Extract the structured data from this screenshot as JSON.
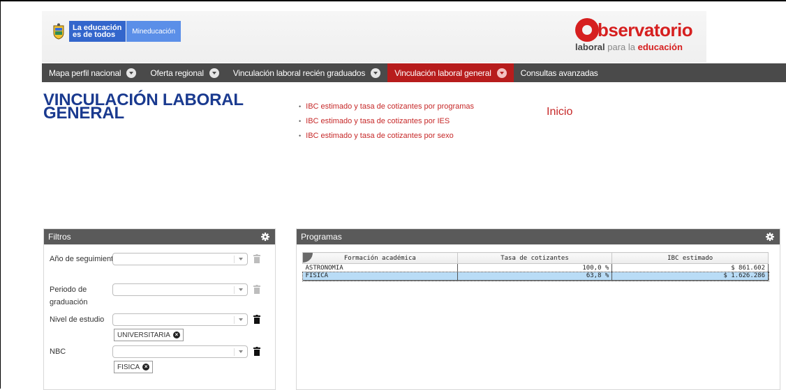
{
  "header": {
    "gov_badge": {
      "line1": "La educación",
      "line2": "es de todos",
      "ministry": "Mineducación"
    },
    "observatorio": {
      "word": "bservatorio",
      "sub_bold": "laboral",
      "sub_light": "para la",
      "sub_red": "educación"
    }
  },
  "nav": {
    "items": [
      {
        "label": "Mapa perfil nacional",
        "has_caret": true,
        "active": false
      },
      {
        "label": "Oferta regional",
        "has_caret": true,
        "active": false
      },
      {
        "label": "Vinculación laboral recién graduados",
        "has_caret": true,
        "active": false
      },
      {
        "label": "Vinculación laboral general",
        "has_caret": true,
        "active": true
      },
      {
        "label": "Consultas avanzadas",
        "has_caret": false,
        "active": false
      }
    ]
  },
  "page": {
    "title": "VINCULACIÓN LABORAL GENERAL",
    "links": [
      "IBC estimado y tasa de cotizantes por programas",
      "IBC estimado y tasa de cotizantes por IES",
      "IBC estimado y tasa de cotizantes por sexo"
    ],
    "inicio": "Inicio"
  },
  "filters": {
    "title": "Filtros",
    "fields": [
      {
        "label": "Año de seguimiento",
        "value": "",
        "tag": ""
      },
      {
        "label": "Periodo de graduación",
        "value": "",
        "tag": ""
      },
      {
        "label": "Nivel de estudio",
        "value": "",
        "tag": "UNIVERSITARIA"
      },
      {
        "label": "NBC",
        "value": "",
        "tag": "FISICA"
      }
    ]
  },
  "programs": {
    "title": "Programas",
    "columns": [
      "Formación académica",
      "Tasa de cotizantes",
      "IBC estimado"
    ],
    "rows": [
      {
        "cells": [
          "ASTRONOMIA",
          "100,0 %",
          "$ 861.602"
        ],
        "selected": false
      },
      {
        "cells": [
          "FISICA",
          "63,8 %",
          "$ 1.626.286"
        ],
        "selected": true
      }
    ]
  },
  "icons": {
    "gear": "gear-icon",
    "trash": "trash-icon",
    "caret": "chevron-down-icon"
  },
  "colors": {
    "nav_bg": "#4a4a4a",
    "nav_active": "#b71c1c",
    "title_blue": "#1a3a8f",
    "link_red": "#c62828",
    "row_selected": "#b9dcf6"
  }
}
